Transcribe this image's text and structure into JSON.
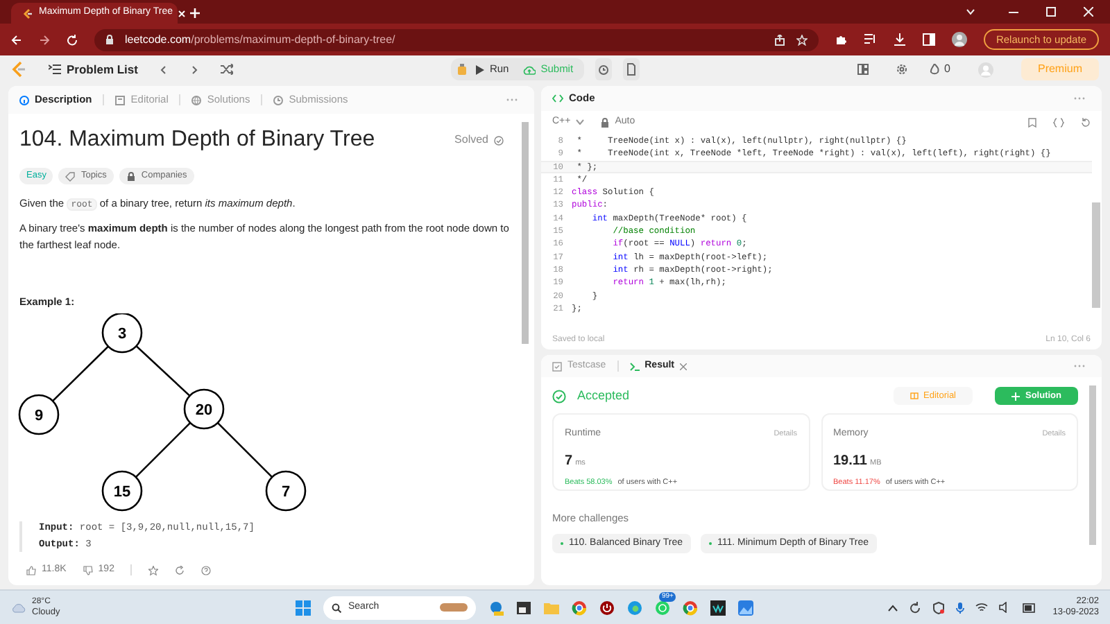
{
  "browser": {
    "tab_title": "Maximum Depth of Binary Tree",
    "url_host": "leetcode.com",
    "url_path": "/problems/maximum-depth-of-binary-tree/",
    "relaunch": "Relaunch to update"
  },
  "nav": {
    "problem_list": "Problem List",
    "run": "Run",
    "submit": "Submit",
    "streak": "0",
    "premium": "Premium"
  },
  "left_tabs": [
    {
      "label": "Description",
      "selected": true
    },
    {
      "label": "Editorial",
      "selected": false
    },
    {
      "label": "Solutions",
      "selected": false
    },
    {
      "label": "Submissions",
      "selected": false
    }
  ],
  "problem": {
    "title": "104. Maximum Depth of Binary Tree",
    "status": "Solved",
    "difficulty": "Easy",
    "tags": [
      "Topics",
      "Companies"
    ],
    "intro": [
      {
        "kind": "text",
        "text": "Given the "
      },
      {
        "kind": "code",
        "text": "root"
      },
      {
        "kind": "text",
        "text": " of a binary tree, return *its maximum depth*."
      }
    ],
    "paragraph": "A binary tree's **maximum depth** is the number of nodes along the longest path from the root node down to the farthest leaf node.",
    "example_title": "Example 1:",
    "tree": [
      {
        "value": "3",
        "children": [
          {
            "value": "9"
          },
          {
            "value": "20",
            "children": [
              {
                "value": "15"
              },
              {
                "value": "7"
              }
            ]
          }
        ]
      }
    ],
    "example": [
      {
        "label": "Input:",
        "value": "root = [3,9,20,null,null,15,7]"
      },
      {
        "label": "Output:",
        "value": "3"
      }
    ],
    "likes": "11.8K",
    "dislikes": "192"
  },
  "code_panel": {
    "title": "Code",
    "language": "C++",
    "mode": "Auto",
    "saved": "Saved to local",
    "cursor": "Ln 10, Col 6",
    "lines": [
      {
        "n": "8",
        "parts": [
          {
            "kind": "plain",
            "t": " *     TreeNode(int x) : val(x), left(nullptr), right(nullptr) {}"
          }
        ]
      },
      {
        "n": "9",
        "parts": [
          {
            "kind": "plain",
            "t": " *     TreeNode(int x, TreeNode *left, TreeNode *right) : val(x), left(left), right(right) {}"
          }
        ]
      },
      {
        "n": "10",
        "parts": [
          {
            "kind": "plain",
            "t": " * };"
          }
        ]
      },
      {
        "n": "11",
        "parts": [
          {
            "kind": "plain",
            "t": " */"
          }
        ]
      },
      {
        "n": "12",
        "parts": [
          {
            "kind": "keyword",
            "t": "class"
          },
          {
            "kind": "plain",
            "t": " Solution {"
          }
        ]
      },
      {
        "n": "13",
        "parts": [
          {
            "kind": "keyword",
            "t": "public"
          },
          {
            "kind": "plain",
            "t": ":"
          }
        ]
      },
      {
        "n": "14",
        "parts": [
          {
            "kind": "type",
            "t": "    int"
          },
          {
            "kind": "plain",
            "t": " maxDepth(TreeNode* root) {"
          }
        ]
      },
      {
        "n": "15",
        "parts": [
          {
            "kind": "comment",
            "t": "        //base condition"
          }
        ]
      },
      {
        "n": "16",
        "parts": [
          {
            "kind": "keyword",
            "t": "        if"
          },
          {
            "kind": "plain",
            "t": "(root == "
          },
          {
            "kind": "type",
            "t": "NULL"
          },
          {
            "kind": "plain",
            "t": ") "
          },
          {
            "kind": "keyword",
            "t": "return"
          },
          {
            "kind": "number",
            "t": " 0"
          },
          {
            "kind": "plain",
            "t": ";"
          }
        ]
      },
      {
        "n": "17",
        "parts": [
          {
            "kind": "type",
            "t": "        int"
          },
          {
            "kind": "plain",
            "t": " lh = maxDepth(root->left);"
          }
        ]
      },
      {
        "n": "18",
        "parts": [
          {
            "kind": "type",
            "t": "        int"
          },
          {
            "kind": "plain",
            "t": " rh = maxDepth(root->right);"
          }
        ]
      },
      {
        "n": "19",
        "parts": [
          {
            "kind": "keyword",
            "t": "        return"
          },
          {
            "kind": "number",
            "t": " 1"
          },
          {
            "kind": "plain",
            "t": " + max(lh,rh);"
          }
        ]
      },
      {
        "n": "20",
        "parts": [
          {
            "kind": "plain",
            "t": "    }"
          }
        ]
      },
      {
        "n": "21",
        "parts": [
          {
            "kind": "plain",
            "t": "};"
          }
        ]
      }
    ]
  },
  "result_tabs": [
    {
      "label": "Testcase",
      "selected": false
    },
    {
      "label": "Result",
      "selected": true
    }
  ],
  "result": {
    "verdict": "Accepted",
    "editorial": "Editorial",
    "solution": "Solution",
    "stats": [
      {
        "label": "Runtime",
        "details": "Details",
        "value": "7",
        "unit": "ms",
        "beats": "Beats 58.03%",
        "color": "#2cbb5d",
        "suffix": "of users with C++"
      },
      {
        "label": "Memory",
        "details": "Details",
        "value": "19.11",
        "unit": "MB",
        "beats": "Beats 11.17%",
        "color": "#ef4743",
        "suffix": "of users with C++"
      }
    ],
    "more": "More challenges",
    "challenges": [
      "110. Balanced Binary Tree",
      "111. Minimum Depth of Binary Tree"
    ]
  },
  "taskbar": {
    "temperature": "28°C",
    "weather": "Cloudy",
    "search": "Search",
    "badge": "99+",
    "time": "22:02",
    "date": "13-09-2023"
  }
}
